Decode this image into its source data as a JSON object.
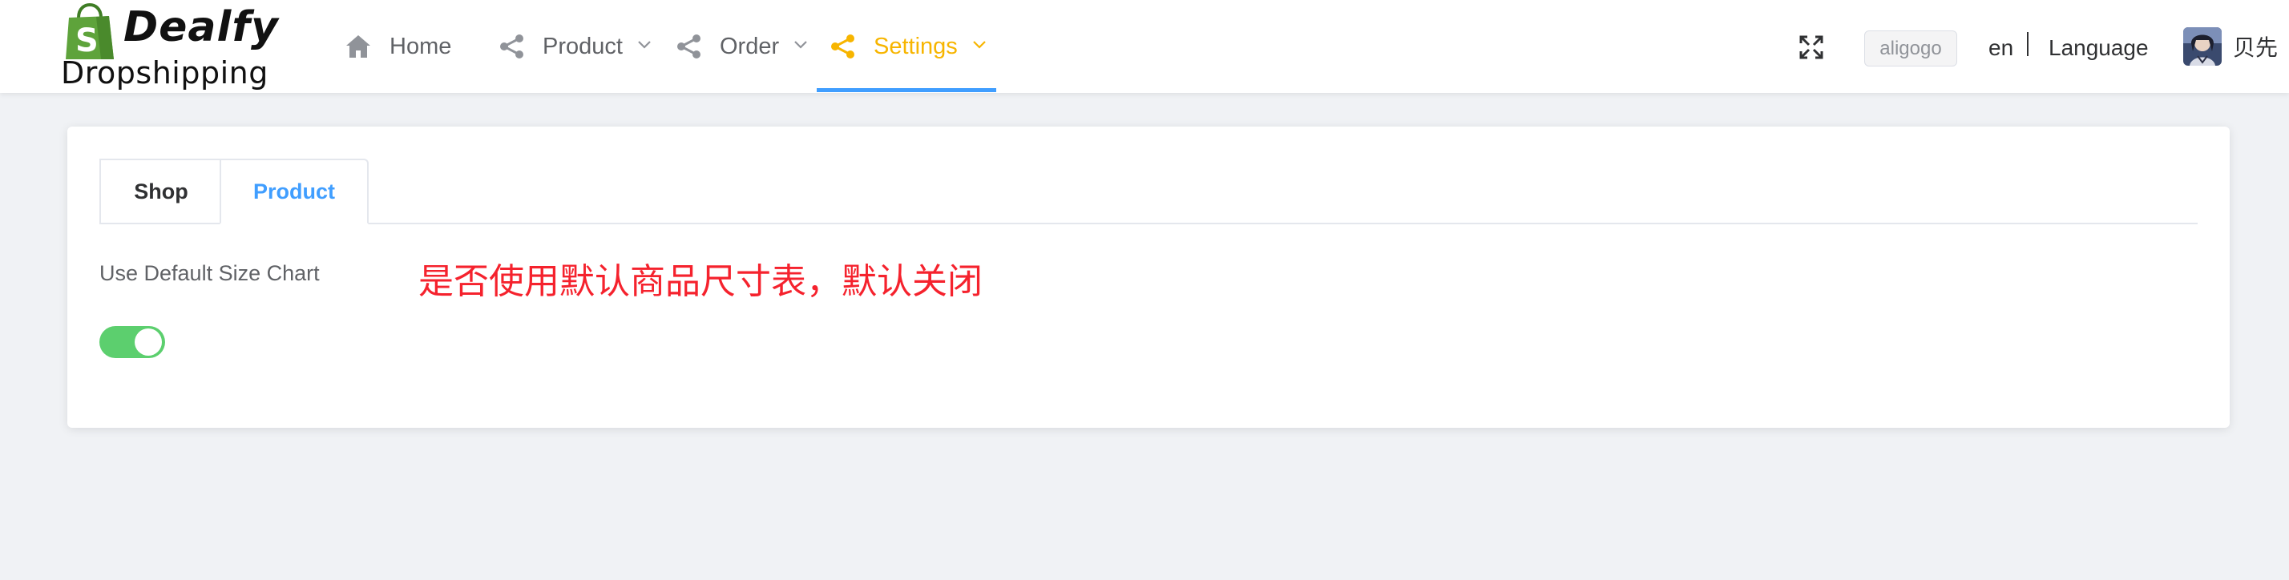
{
  "brand": {
    "title": "Dealfy",
    "subtitle": "Dropshipping",
    "bag_color": "#5ea33b"
  },
  "nav": {
    "items": [
      {
        "label": "Home",
        "icon": "home-icon",
        "has_dropdown": false,
        "active": false
      },
      {
        "label": "Product",
        "icon": "share-icon",
        "has_dropdown": true,
        "active": false
      },
      {
        "label": "Order",
        "icon": "share-icon",
        "has_dropdown": true,
        "active": false
      },
      {
        "label": "Settings",
        "icon": "share-icon",
        "has_dropdown": true,
        "active": true
      }
    ],
    "active_color": "#f7b500",
    "underline_color": "#409eff"
  },
  "header_right": {
    "fullscreen_icon": "fullscreen-icon",
    "tenant": "aligogo",
    "lang_code": "en",
    "lang_label": "Language",
    "user_name": "贝先"
  },
  "tabs": [
    {
      "label": "Shop",
      "active": false
    },
    {
      "label": "Product",
      "active": true
    }
  ],
  "settings": {
    "size_chart_label": "Use Default Size Chart",
    "size_chart_enabled": true,
    "annotation": "是否使用默认商品尺寸表，默认关闭"
  },
  "colors": {
    "primary": "#409eff",
    "switch_on": "#5ccf6e",
    "annotation": "#f5222d",
    "background": "#f0f2f5"
  }
}
